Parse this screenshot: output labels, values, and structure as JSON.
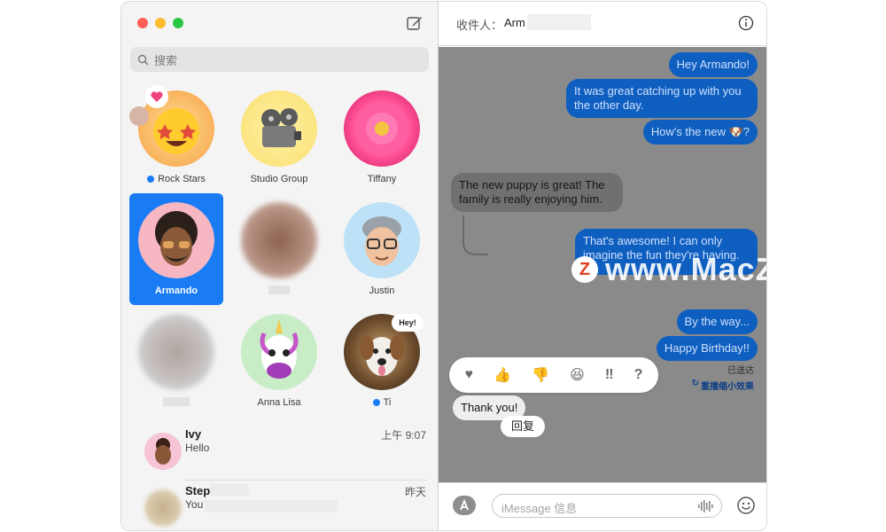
{
  "sidebar": {
    "search_placeholder": "搜索",
    "pins": [
      {
        "name": "Rock Stars",
        "unread": true,
        "dot_color": "#1a7cf5"
      },
      {
        "name": "Studio Group",
        "unread": false
      },
      {
        "name": "Tiffany",
        "unread": false
      },
      {
        "name": "Armando",
        "unread": false,
        "selected": true
      },
      {
        "name": "",
        "unread": false
      },
      {
        "name": "Justin",
        "unread": false
      },
      {
        "name": "",
        "unread": false
      },
      {
        "name": "Anna Lisa",
        "unread": false
      },
      {
        "name": "Ti",
        "unread": true,
        "bubble": "Hey!"
      }
    ],
    "conversations": [
      {
        "name": "Ivy",
        "preview": "Hello",
        "time": "上午 9:07"
      },
      {
        "name": "Step",
        "preview": "You",
        "time": "昨天"
      }
    ]
  },
  "chat": {
    "to_label": "收件人：",
    "to_name": "Arm",
    "messages": [
      {
        "from": "me",
        "text": "Hey Armando!"
      },
      {
        "from": "me",
        "text": "It was great catching up with you the other day."
      },
      {
        "from": "me",
        "text": "How's the new 🐶?"
      },
      {
        "from": "them",
        "text": "The new puppy is great! The family is really enjoying him."
      },
      {
        "from": "me",
        "text": "That's awesome! I can only imagine the fun they're having."
      },
      {
        "from": "me",
        "text": "By the way..."
      },
      {
        "from": "me",
        "text": "Happy Birthday!!"
      },
      {
        "from": "them",
        "text": "Thank you!"
      }
    ],
    "delivered_label": "已送达",
    "replay_label": "重播缩小效果",
    "reply_button": "回复",
    "input_placeholder": "iMessage 信息",
    "tapbacks": [
      "♥",
      "👍",
      "👎",
      "😆",
      "‼",
      "?"
    ]
  },
  "watermark": "www.MacZ.com",
  "colors": {
    "accent": "#1a7cf5",
    "bubble_blue": "#0f5fc0",
    "thread_dim": "#8a8a8a"
  }
}
